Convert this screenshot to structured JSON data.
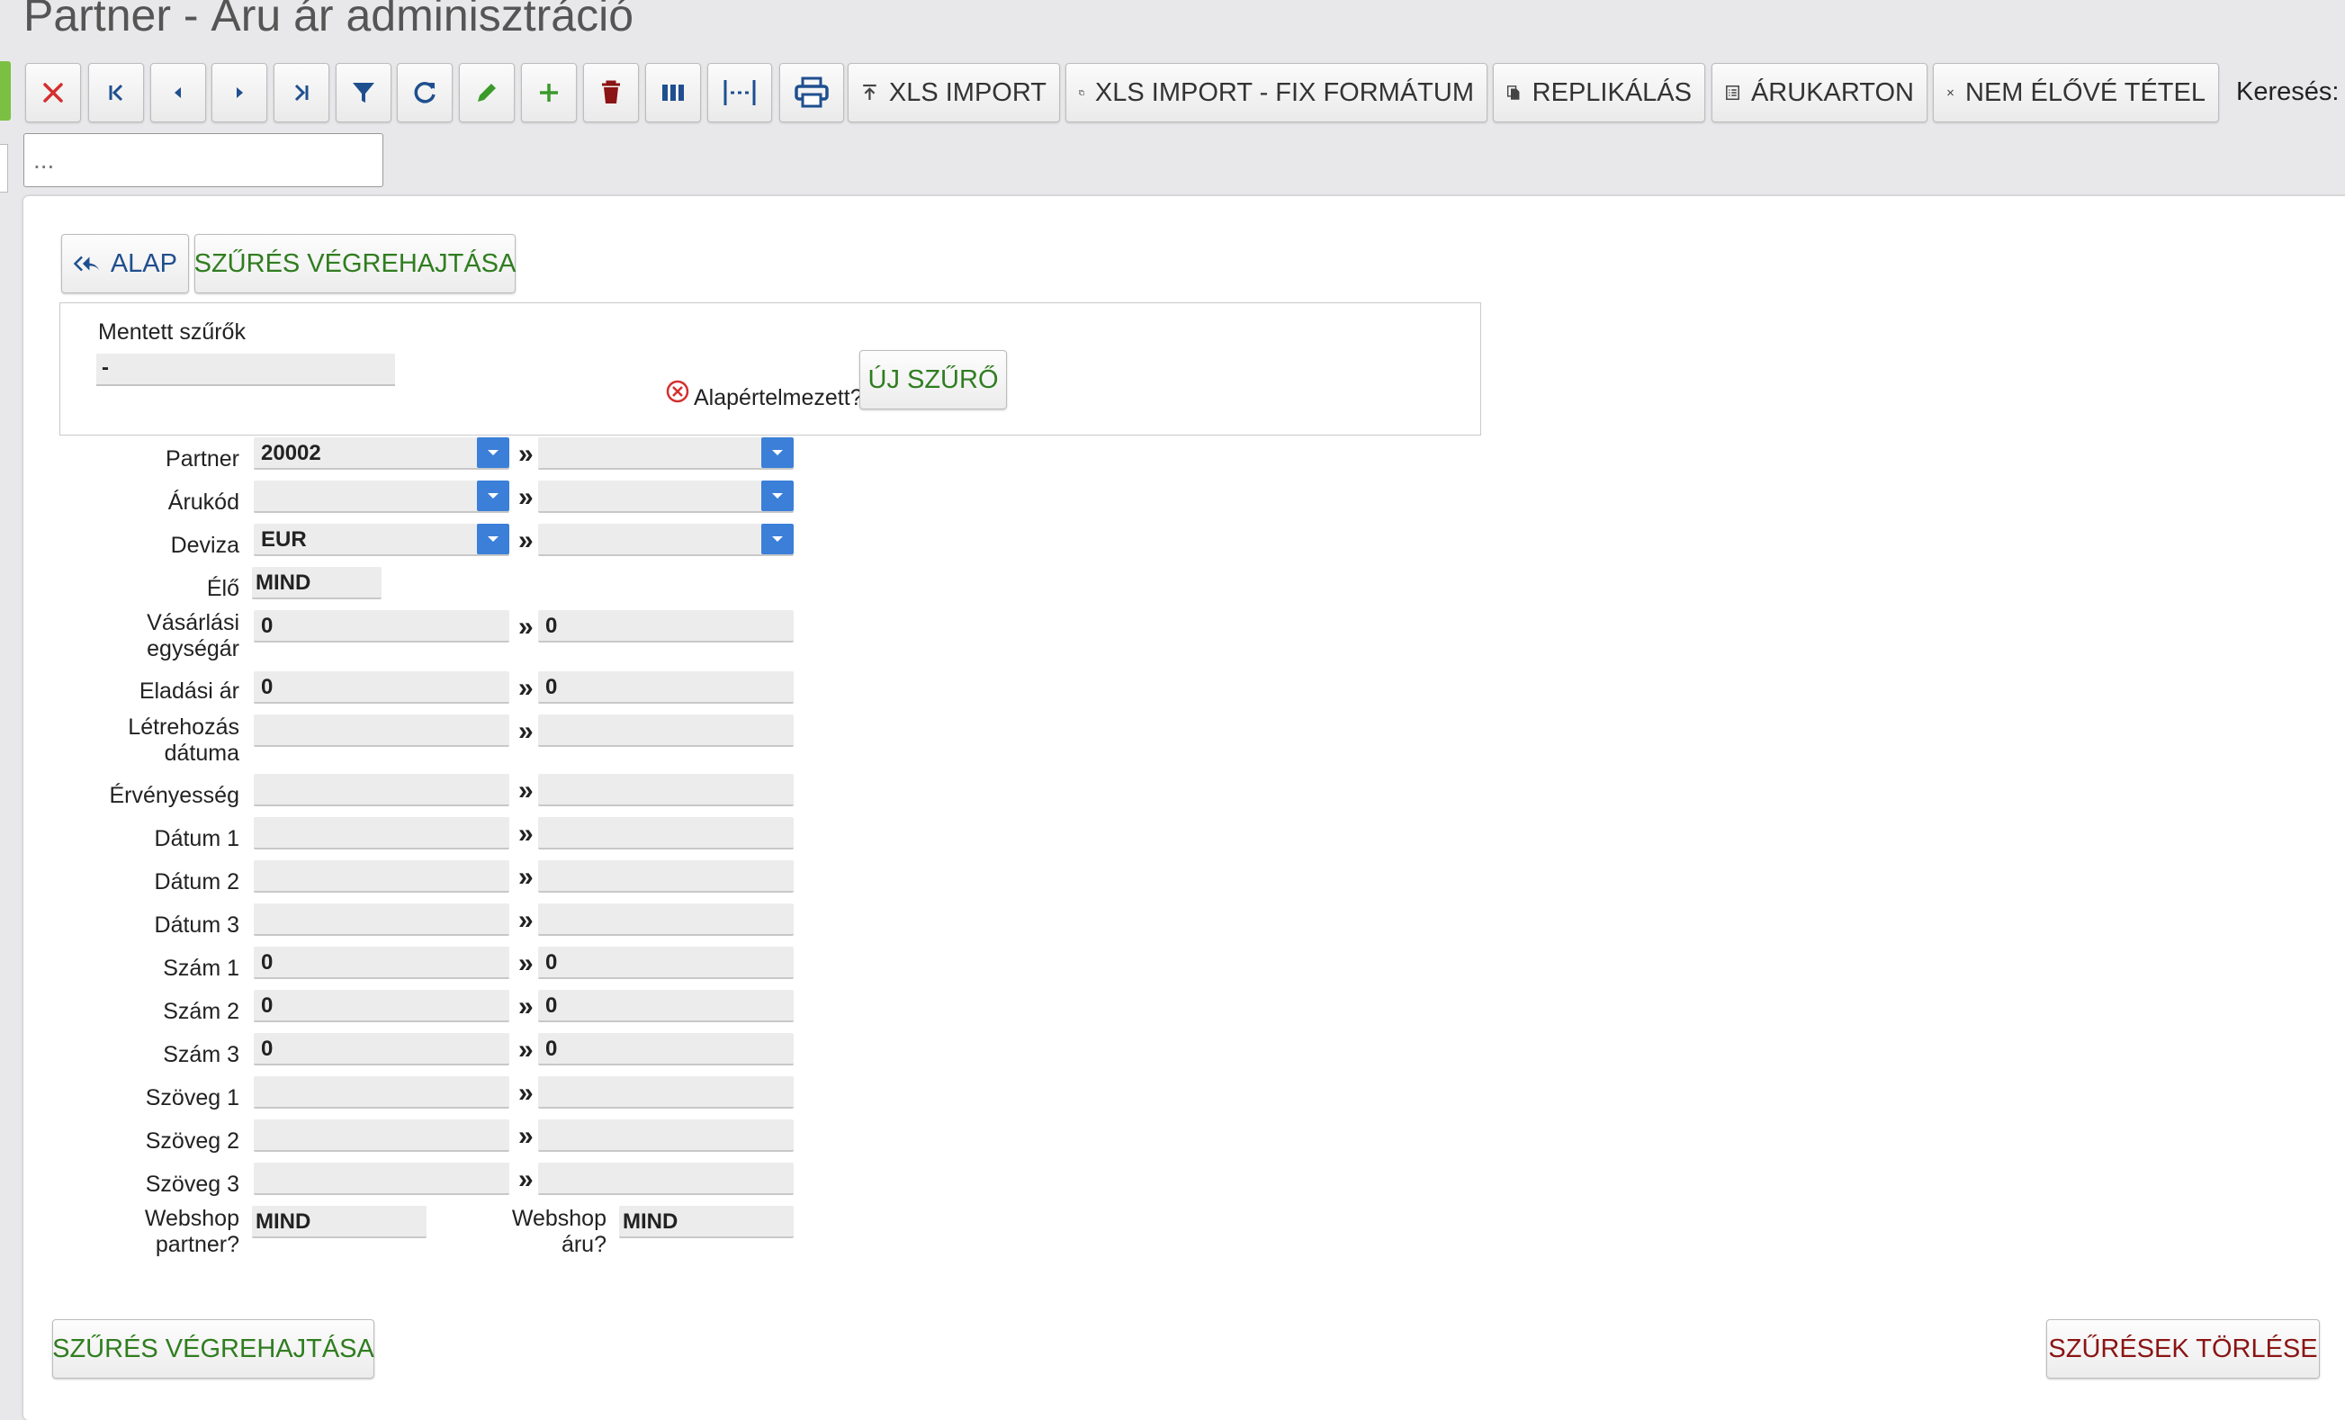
{
  "window": {
    "title": "Partner - Áru ár adminisztráció"
  },
  "toolbar": {
    "xls_import": "XLS IMPORT",
    "xls_import_fix": "XLS IMPORT - FIX FORMÁTUM",
    "replikalas": "REPLIKÁLÁS",
    "arukarton": "ÁRUKARTON",
    "nem_elove": "NEM ÉLŐVÉ TÉTEL",
    "search_label": "Keresés:",
    "search_placeholder": "..."
  },
  "filter": {
    "alap_label": "ALAP",
    "execute_label": "SZŰRÉS VÉGREHAJTÁSA",
    "saved_filters_label": "Mentett szűrők",
    "saved_filters_value": "-",
    "default_label": "Alapértelmezett?",
    "new_filter_label": "ÚJ SZŰRŐ",
    "range_separator": "»",
    "rows": {
      "partner": {
        "label": "Partner",
        "from": "20002",
        "to": ""
      },
      "arukod": {
        "label": "Árukód",
        "from": "",
        "to": ""
      },
      "deviza": {
        "label": "Deviza",
        "from": "EUR",
        "to": ""
      },
      "elo": {
        "label": "Élő",
        "value": "MIND"
      },
      "vasarlasi": {
        "label1": "Vásárlási",
        "label2": "egységár",
        "from": "0",
        "to": "0"
      },
      "eladasi": {
        "label": "Eladási ár",
        "from": "0",
        "to": "0"
      },
      "letrehozas": {
        "label1": "Létrehozás",
        "label2": "dátuma",
        "from": "",
        "to": ""
      },
      "ervenyesseg": {
        "label": "Érvényesség",
        "from": "",
        "to": ""
      },
      "datum1": {
        "label": "Dátum 1",
        "from": "",
        "to": ""
      },
      "datum2": {
        "label": "Dátum 2",
        "from": "",
        "to": ""
      },
      "datum3": {
        "label": "Dátum 3",
        "from": "",
        "to": ""
      },
      "szam1": {
        "label": "Szám 1",
        "from": "0",
        "to": "0"
      },
      "szam2": {
        "label": "Szám 2",
        "from": "0",
        "to": "0"
      },
      "szam3": {
        "label": "Szám 3",
        "from": "0",
        "to": "0"
      },
      "szoveg1": {
        "label": "Szöveg 1",
        "from": "",
        "to": ""
      },
      "szoveg2": {
        "label": "Szöveg 2",
        "from": "",
        "to": ""
      },
      "szoveg3": {
        "label": "Szöveg 3",
        "from": "",
        "to": ""
      },
      "webshop_partner": {
        "label1": "Webshop",
        "label2": "partner?",
        "value": "MIND"
      },
      "webshop_aru": {
        "label1": "Webshop",
        "label2": "áru?",
        "value": "MIND"
      }
    },
    "clear_label": "SZŰRÉSEK TÖRLÉSE"
  },
  "colors": {
    "accent_green": "#2f7d1f",
    "accent_blue": "#3b7fd9",
    "danger": "#d32f2f",
    "delete": "#8b1414"
  },
  "icons": [
    "close-icon",
    "first-page-icon",
    "prev-icon",
    "next-icon",
    "last-page-icon",
    "filter-icon",
    "refresh-icon",
    "edit-icon",
    "add-icon",
    "delete-icon",
    "columns-icon",
    "column-width-icon",
    "print-icon",
    "upload-icon",
    "copy-icon",
    "files-icon",
    "list-icon",
    "x-icon",
    "reply-all-icon",
    "error-circle-icon",
    "dropdown-arrow-icon"
  ]
}
